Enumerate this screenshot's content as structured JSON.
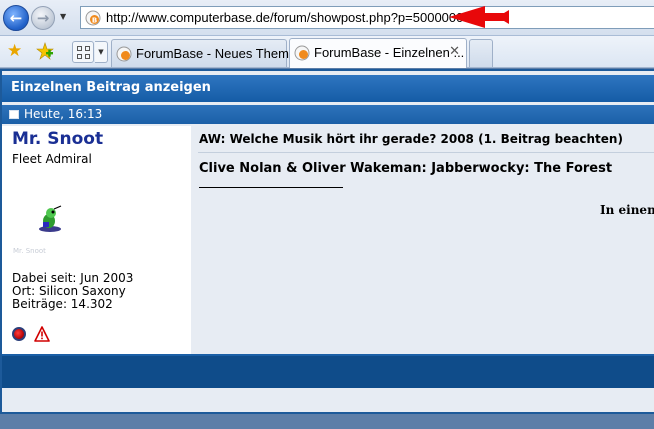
{
  "browser": {
    "url": "http://www.computerbase.de/forum/showpost.php?p=5000000",
    "tabs": [
      {
        "label": "ForumBase - Neues Them..."
      },
      {
        "label": "ForumBase - Einzelnen ..."
      }
    ],
    "icons": [
      "back-icon",
      "forward-icon",
      "site-icon",
      "favorites-star-icon",
      "add-favorite-icon",
      "quick-tabs-icon",
      "tab-close-icon"
    ],
    "annotation_arrow_color": "#e8080a"
  },
  "page": {
    "title": "Einzelnen Beitrag anzeigen",
    "post_date": "Heute, 16:13",
    "user": {
      "name": "Mr. Snoot",
      "title": "Fleet Admiral",
      "avatar_caption": "Mr. Snoot",
      "joined": "Dabei seit: Jun 2003",
      "location": "Ort: Silicon Saxony",
      "posts": "Beiträge: 14.302"
    },
    "post": {
      "subject": "AW: Welche Musik hört ihr gerade? 2008 (1. Beitrag beachten)",
      "line1": "Clive Nolan & Oliver Wakeman: Jabberwocky: The Forest",
      "line2": "In einem"
    },
    "colors": {
      "header_blue": "#1d64ae",
      "username": "#1a2f94",
      "footer": "#0f4c8a"
    }
  }
}
